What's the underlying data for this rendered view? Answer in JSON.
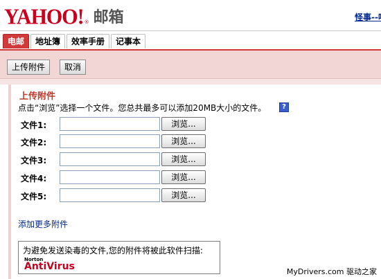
{
  "header": {
    "logo_text": "YAHOO!",
    "logo_tm": "®",
    "logo_mail": "邮箱",
    "top_link": "怪事--喝"
  },
  "tabs": [
    {
      "label": "电邮",
      "active": true
    },
    {
      "label": "地址簿",
      "active": false
    },
    {
      "label": "效率手册",
      "active": false
    },
    {
      "label": "记事本",
      "active": false
    }
  ],
  "toolbar": {
    "upload_label": "上传附件",
    "cancel_label": "取消"
  },
  "upload": {
    "title": "上传附件",
    "instructions": "点击“浏览”选择一个文件。您总共最多可以添加20MB大小的文件。",
    "help_icon": "?",
    "files": [
      {
        "label": "文件1:",
        "value": "",
        "browse": "浏览..."
      },
      {
        "label": "文件2:",
        "value": "",
        "browse": "浏览..."
      },
      {
        "label": "文件3:",
        "value": "",
        "browse": "浏览..."
      },
      {
        "label": "文件4:",
        "value": "",
        "browse": "浏览..."
      },
      {
        "label": "文件5:",
        "value": "",
        "browse": "浏览..."
      }
    ],
    "add_more": "添加更多附件"
  },
  "scan": {
    "text": "为避免发送染毒的文件,您的附件将被此软件扫描:",
    "norton_small": "Norton",
    "norton_big": "AntiVirus"
  },
  "watermark": "MyDrivers.com 驱动之家",
  "colors": {
    "brand_red": "#c8001e",
    "tab_active": "#d23a3a",
    "toolbar_bg": "#f2d6d6",
    "link_blue": "#00288c"
  }
}
